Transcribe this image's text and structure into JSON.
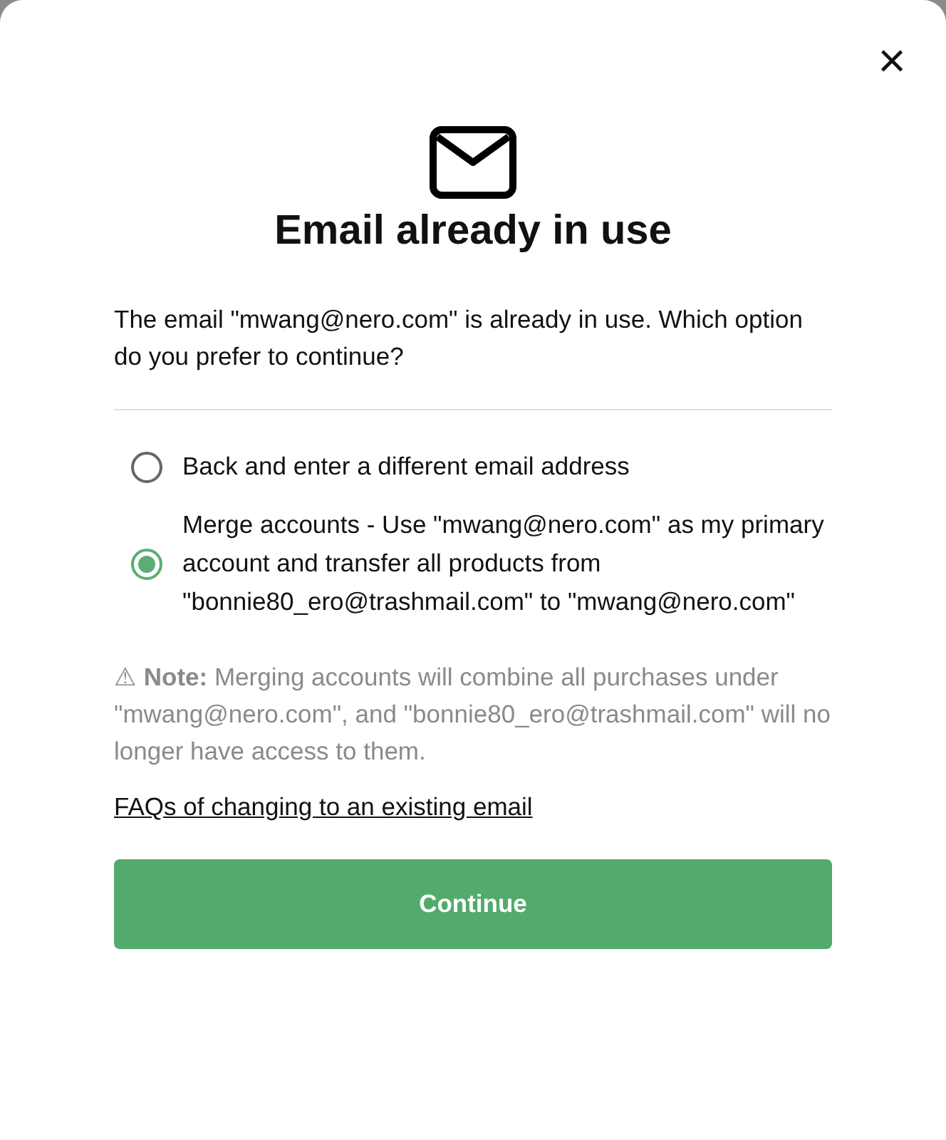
{
  "dialog": {
    "close": "×",
    "title": "Email already in use",
    "message": "The email \"mwang@nero.com\" is already in use. Which option do you prefer to continue?",
    "options": [
      {
        "label": "Back and enter a different email address",
        "selected": false
      },
      {
        "label": "Merge accounts - Use \"mwang@nero.com\" as my primary account and transfer all products from \"bonnie80_ero@trashmail.com\" to \"mwang@nero.com\"",
        "selected": true
      }
    ],
    "note": "⚠ **Note:** Merging accounts will combine all purchases under \"mwang@nero.com\", and \"bonnie80_ero@trashmail.com\" will no longer have access to them.",
    "link": "FAQs of changing to an existing email",
    "button": "Continue"
  }
}
